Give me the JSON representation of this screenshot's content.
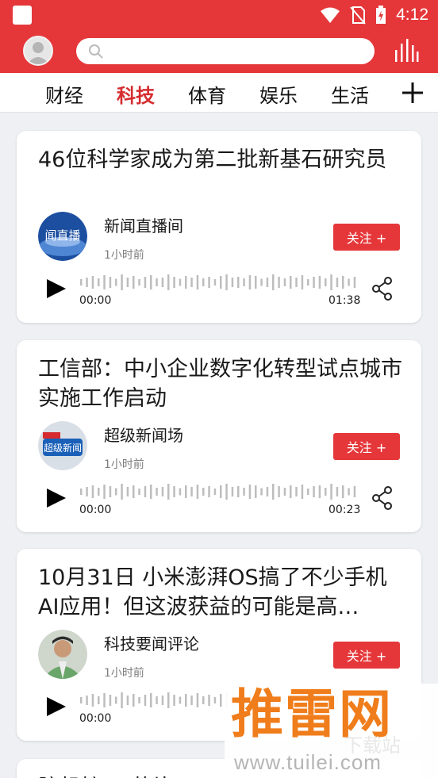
{
  "status_bar": {
    "time": "4:12"
  },
  "search": {
    "placeholder": ""
  },
  "tabs": [
    {
      "label": "财经",
      "active": false
    },
    {
      "label": "科技",
      "active": true
    },
    {
      "label": "体育",
      "active": false
    },
    {
      "label": "娱乐",
      "active": false
    },
    {
      "label": "生活",
      "active": false
    }
  ],
  "cards": [
    {
      "title": "46位科学家成为第二批新基石研究员",
      "source": "新闻直播间",
      "time": "1小时前",
      "follow_label": "关注 +",
      "audio_start": "00:00",
      "audio_end": "01:38"
    },
    {
      "title": "工信部：中小企业数字化转型试点城市实施工作启动",
      "source": "超级新闻场",
      "time": "1小时前",
      "follow_label": "关注 +",
      "audio_start": "00:00",
      "audio_end": "00:23"
    },
    {
      "title": "10月31日 小米澎湃OS搞了不少手机AI应用！但这波获益的可能是高…",
      "source": "科技要闻评论",
      "time": "1小时前",
      "follow_label": "关注 +",
      "audio_start": "00:00",
      "audio_end": ""
    }
  ],
  "card4_title": "脑机接口 芯片",
  "watermark": {
    "main": "推雷网",
    "faint": "下载站",
    "url": "www.tuilei.com"
  },
  "colors": {
    "brand_red": "#e5373a",
    "active_tab": "#d62c2f",
    "watermark_orange": "#f07d1b"
  }
}
